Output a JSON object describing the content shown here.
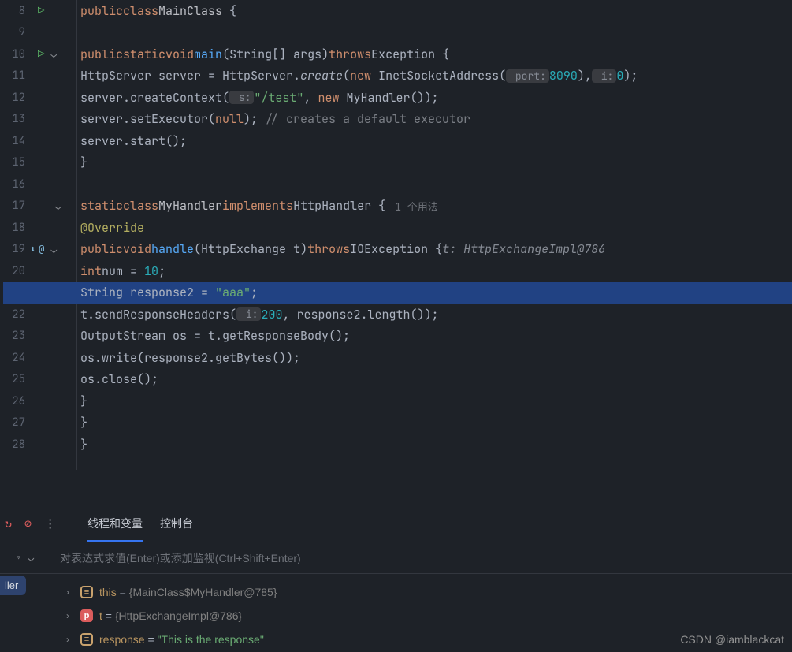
{
  "gutter": {
    "lines": [
      "8",
      "9",
      "10",
      "11",
      "12",
      "13",
      "14",
      "15",
      "16",
      "17",
      "18",
      "19",
      "20",
      "",
      "22",
      "23",
      "24",
      "25",
      "26",
      "27",
      "28"
    ]
  },
  "code": {
    "l8": {
      "kw1": "public",
      "kw2": "class",
      "cls": "MainClass",
      "open": " {"
    },
    "l10": {
      "kw1": "public",
      "kw2": "static",
      "kw3": "void",
      "fn": "main",
      "sig": "(String[] args)",
      "kw4": "throws",
      "ex": "Exception",
      "open": " {"
    },
    "l11": {
      "t1": "HttpServer server = HttpServer.",
      "m": "create",
      "p1": "(",
      "kw": "new",
      "t2": " InetSocketAddress(",
      "h1": " port:",
      "n1": "8090",
      "t3": "),",
      "h2": " i:",
      "n2": "0",
      "t4": ");"
    },
    "l12": {
      "t1": "server.createContext(",
      "h1": " s:",
      "s": "\"/test\"",
      "t2": ", ",
      "kw": "new",
      "t3": " MyHandler());"
    },
    "l13": {
      "t1": "server.setExecutor(",
      "kw": "null",
      "t2": "); ",
      "cm": "// creates a default executor"
    },
    "l14": {
      "t1": "server.start();"
    },
    "l15": {
      "t1": "}"
    },
    "l17": {
      "kw1": "static",
      "kw2": "class",
      "cls": "MyHandler",
      "kw3": "implements",
      "intf": "HttpHandler",
      "open": " {",
      "us": "1 个用法"
    },
    "l18": {
      "an": "@Override"
    },
    "l19": {
      "kw1": "public",
      "kw2": "void",
      "fn": "handle",
      "sig": "(HttpExchange ",
      "p": "t",
      "sig2": ")",
      "kw3": "throws",
      "ex": "IOException",
      "open": " {",
      "hint": "t: HttpExchangeImpl@786"
    },
    "l20": {
      "kw": "int",
      "v": "num",
      "eq": " = ",
      "n": "10",
      "t": ";"
    },
    "l21": {
      "t1": "String ",
      "v": "response2",
      "eq": " = ",
      "s": "\"aaa\"",
      "t2": ";"
    },
    "l22": {
      "v": "t",
      "t1": ".sendResponseHeaders(",
      "h": " i:",
      "n": "200",
      "t2": ", ",
      "v2": "response2",
      "t3": ".length());"
    },
    "l23": {
      "t1": "OutputStream os = ",
      "v": "t",
      "t2": ".getResponseBody();"
    },
    "l24": {
      "t1": "os.write(",
      "v": "response2",
      "t2": ".getBytes());"
    },
    "l25": {
      "t1": "os.close();"
    },
    "l26": {
      "t1": "}"
    },
    "l27": {
      "t1": "}"
    },
    "l28": {
      "t1": "}"
    }
  },
  "debug": {
    "tab1": "线程和变量",
    "tab2": "控制台",
    "eval_placeholder": "对表达式求值(Enter)或添加监视(Ctrl+Shift+Enter)",
    "frame_label": "ller",
    "vars": [
      {
        "icon": "obj",
        "name": "this",
        "sep": " = ",
        "val": "{MainClass$MyHandler@785}"
      },
      {
        "icon": "p",
        "name": "t",
        "sep": " = ",
        "val": "{HttpExchangeImpl@786}"
      },
      {
        "icon": "obj",
        "name": "response",
        "sep": " = ",
        "val": "\"This is the response\"",
        "isStr": true
      }
    ]
  },
  "watermark": "CSDN @iamblackcat"
}
